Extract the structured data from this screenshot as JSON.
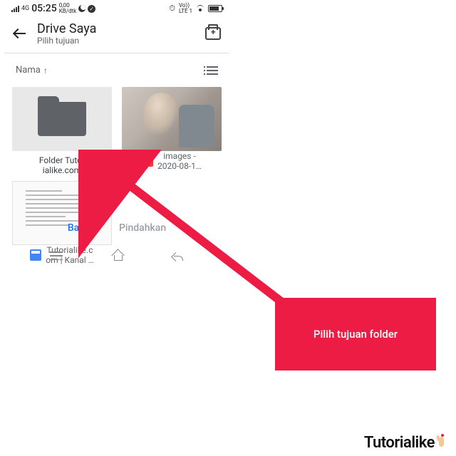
{
  "status": {
    "network": "4G",
    "time": "05:25",
    "speed_value": "0,00",
    "speed_unit": "KB/dtk",
    "vo": "Vo))",
    "lte1": "LTE",
    "lte2": "1"
  },
  "header": {
    "title": "Drive Saya",
    "subtitle": "Pilih tujuan"
  },
  "sort": {
    "label": "Nama",
    "direction": "↑"
  },
  "items": [
    {
      "name": "Folder Tutor\nialike.com",
      "type": "folder"
    },
    {
      "name": "images -\n2020-08-1…",
      "type": "image"
    },
    {
      "name": "Tutorialike.c\nom | Kanal …",
      "type": "web"
    }
  ],
  "actions": {
    "cancel": "Batal",
    "move": "Pindahkan"
  },
  "callout": {
    "text": "Pilih tujuan folder"
  },
  "watermark": "Tutorialike"
}
